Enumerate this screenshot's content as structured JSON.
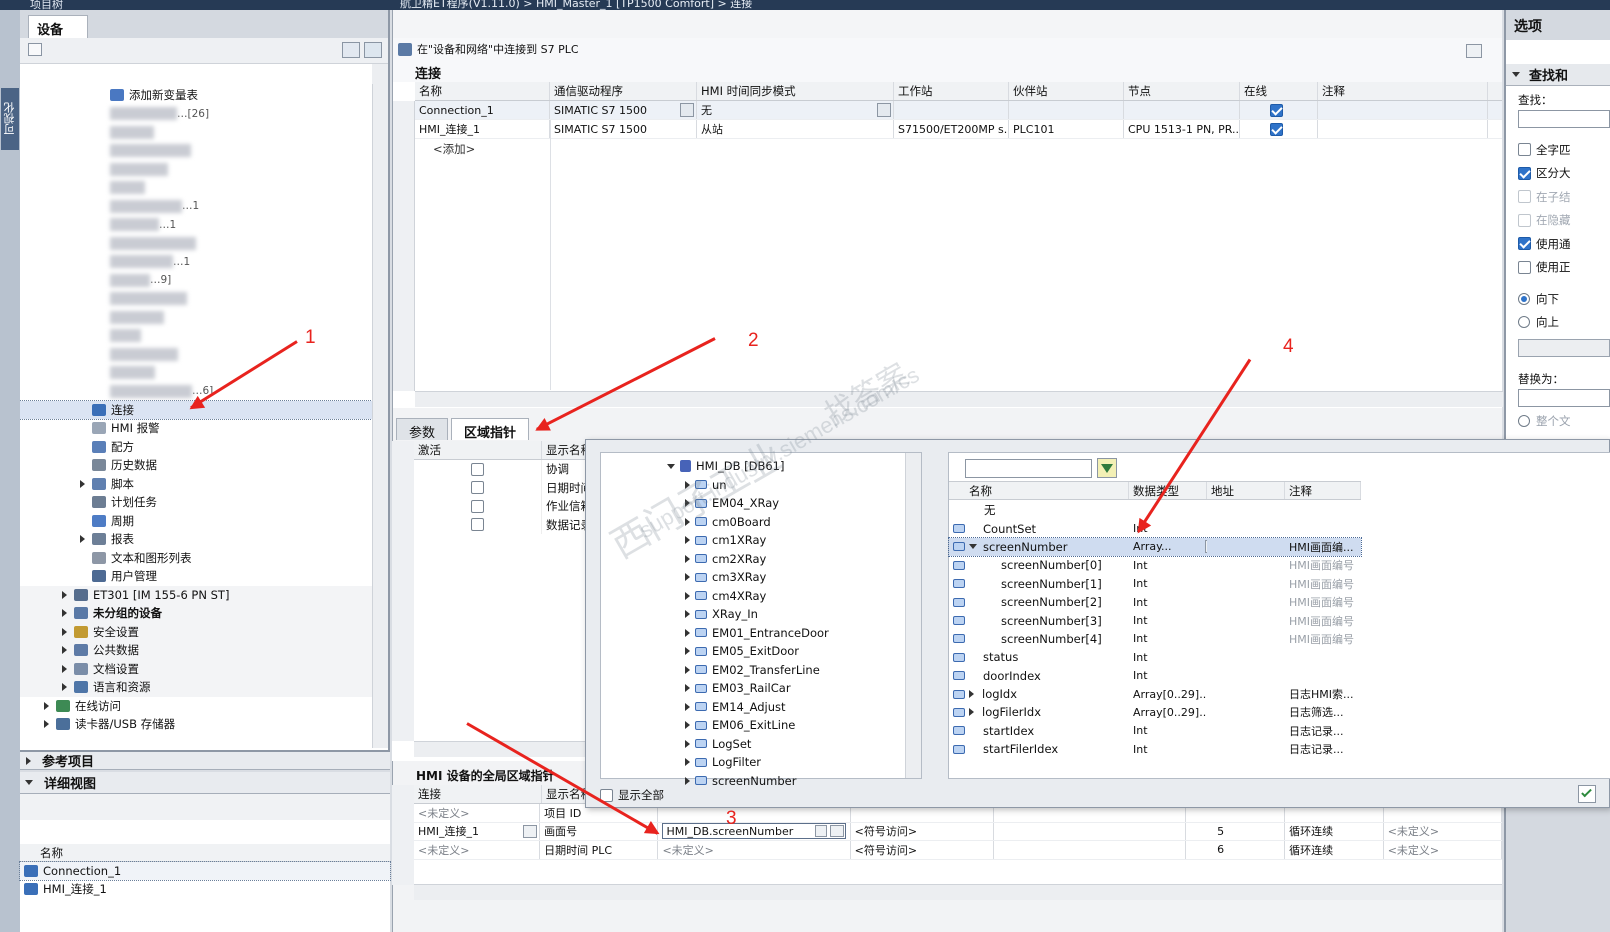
{
  "top": {
    "left_title": "项目树",
    "breadcrumb": "航卫精ET程序(V1.11.0) > HMI_Master_1 [TP1500 Comfort] > 连接",
    "right_title": "选项"
  },
  "left_vtab": "可视化",
  "devices": {
    "tab": "设备",
    "tree": [
      {
        "label": "添加新变量表",
        "indent": 90,
        "icon": "#4a78c2"
      },
      {
        "label": "…[26]",
        "indent": 90,
        "blur": true
      },
      {
        "label": "",
        "indent": 90,
        "blur": true
      },
      {
        "label": "",
        "indent": 90,
        "blur": true
      },
      {
        "label": "",
        "indent": 90,
        "blur": true
      },
      {
        "label": "",
        "indent": 90,
        "blur": true
      },
      {
        "label": "…1",
        "indent": 90,
        "blur": true
      },
      {
        "label": "…1",
        "indent": 90,
        "blur": true
      },
      {
        "label": "",
        "indent": 90,
        "blur": true
      },
      {
        "label": "…1",
        "indent": 90,
        "blur": true
      },
      {
        "label": "…9]",
        "indent": 90,
        "blur": true
      },
      {
        "label": "",
        "indent": 90,
        "blur": true
      },
      {
        "label": "",
        "indent": 90,
        "blur": true
      },
      {
        "label": "",
        "indent": 90,
        "blur": true
      },
      {
        "label": "",
        "indent": 90,
        "blur": true
      },
      {
        "label": "",
        "indent": 90,
        "blur": true
      },
      {
        "label": "…6]",
        "indent": 90,
        "blur": true
      },
      {
        "label": "连接",
        "indent": 72,
        "icon": "#3a6fb8",
        "selected": true
      },
      {
        "label": "HMI 报警",
        "indent": 72,
        "icon": "#9aa6b6"
      },
      {
        "label": "配方",
        "indent": 72,
        "icon": "#5a7fb8"
      },
      {
        "label": "历史数据",
        "indent": 72,
        "icon": "#7a8899"
      },
      {
        "label": "脚本",
        "indent": 72,
        "icon": "#6080b0",
        "expand": true
      },
      {
        "label": "计划任务",
        "indent": 72,
        "icon": "#6c7d93"
      },
      {
        "label": "周期",
        "indent": 72,
        "icon": "#4e7cc5"
      },
      {
        "label": "报表",
        "indent": 72,
        "icon": "#6d7f97",
        "expand": true
      },
      {
        "label": "文本和图形列表",
        "indent": 72,
        "icon": "#8d97a6"
      },
      {
        "label": "用户管理",
        "indent": 72,
        "icon": "#4d6a93"
      },
      {
        "label": "ET301 [IM 155-6 PN ST]",
        "indent": 54,
        "icon": "#566d8d",
        "expand": true
      },
      {
        "label": "未分组的设备",
        "indent": 54,
        "icon": "#5a79a6",
        "expand": true,
        "bold": true
      },
      {
        "label": "安全设置",
        "indent": 54,
        "icon": "#c29a32",
        "expand": true
      },
      {
        "label": "公共数据",
        "indent": 54,
        "icon": "#5d7aa6",
        "expand": true
      },
      {
        "label": "文档设置",
        "indent": 54,
        "icon": "#7a8da8",
        "expand": true
      },
      {
        "label": "语言和资源",
        "indent": 54,
        "icon": "#4f76a8",
        "expand": true
      },
      {
        "label": "在线访问",
        "indent": 36,
        "icon": "#3d8a54",
        "expand": true
      },
      {
        "label": "读卡器/USB 存储器",
        "indent": 36,
        "icon": "#4b6f9a",
        "expand": true
      }
    ]
  },
  "ref_projects": "参考项目",
  "detail_view": {
    "title": "详细视图",
    "col_name": "名称",
    "rows": [
      "Connection_1",
      "HMI_连接_1"
    ]
  },
  "connections": {
    "header_line": "在\"设备和网络\"中连接到 S7 PLC",
    "title": "连接",
    "columns": [
      "名称",
      "通信驱动程序",
      "HMI 时间同步模式",
      "工作站",
      "伙伴站",
      "节点",
      "在线",
      "注释"
    ],
    "rows": [
      {
        "name": "Connection_1",
        "driver": "SIMATIC S7 1500",
        "sync": "无",
        "station": "",
        "partner": "",
        "node": "",
        "online": true
      },
      {
        "name": "HMI_连接_1",
        "driver": "SIMATIC S7 1500",
        "sync": "从站",
        "station": "S71500/ET200MP s...",
        "partner": "PLC101",
        "node": "CPU 1513-1 PN, PR...",
        "online": true
      }
    ],
    "add": "<添加>"
  },
  "lower_tabs": [
    "参数",
    "区域指针"
  ],
  "area": {
    "col_active": "激活",
    "col_display": "显示名称",
    "rows": [
      "协调",
      "日期时间",
      "作业信箱",
      "数据记录"
    ]
  },
  "global": {
    "title": "HMI 设备的全局区域指针",
    "col_conn": "连接",
    "col_disp": "显示名称",
    "rows": [
      {
        "conn": "<未定义>",
        "disp": "项目 ID",
        "tag": "",
        "access": "",
        "len": "",
        "mode": "",
        "comment": ""
      },
      {
        "conn": "HMI_连接_1",
        "disp": "画面号",
        "tag": "HMI_DB.screenNumber",
        "access": "<符号访问>",
        "len": "5",
        "mode": "循环连续",
        "comment": "<未定义>"
      },
      {
        "conn": "<未定义>",
        "disp": "日期时间 PLC",
        "tag": "<未定义>",
        "access": "<符号访问>",
        "len": "6",
        "mode": "循环连续",
        "comment": "<未定义>"
      }
    ]
  },
  "popup": {
    "root": "HMI_DB [DB61]",
    "items": [
      "un",
      "EM04_XRay",
      "cm0Board",
      "cm1XRay",
      "cm2XRay",
      "cm3XRay",
      "cm4XRay",
      "XRay_In",
      "EM01_EntranceDoor",
      "EM05_ExitDoor",
      "EM02_TransferLine",
      "EM03_RailCar",
      "EM14_Adjust",
      "EM06_ExitLine",
      "LogSet",
      "LogFilter",
      "screenNumber"
    ],
    "cols": [
      "名称",
      "数据类型",
      "地址",
      "注释"
    ],
    "rows": [
      {
        "name": "无",
        "type": "",
        "comment": "",
        "lvl": 0
      },
      {
        "name": "CountSet",
        "type": "Int",
        "comment": "",
        "lvl": 0
      },
      {
        "name": "screenNumber",
        "type": "Array...",
        "comment": "HMI画面编...",
        "lvl": 0,
        "sel": true,
        "open": true
      },
      {
        "name": "screenNumber[0]",
        "type": "Int",
        "comment": "HMI画面编号",
        "lvl": 1
      },
      {
        "name": "screenNumber[1]",
        "type": "Int",
        "comment": "HMI画面编号",
        "lvl": 1
      },
      {
        "name": "screenNumber[2]",
        "type": "Int",
        "comment": "HMI画面编号",
        "lvl": 1
      },
      {
        "name": "screenNumber[3]",
        "type": "Int",
        "comment": "HMI画面编号",
        "lvl": 1
      },
      {
        "name": "screenNumber[4]",
        "type": "Int",
        "comment": "HMI画面编号",
        "lvl": 1
      },
      {
        "name": "status",
        "type": "Int",
        "comment": "",
        "lvl": 0
      },
      {
        "name": "doorIndex",
        "type": "Int",
        "comment": "",
        "lvl": 0
      },
      {
        "name": "logIdx",
        "type": "Array[0..29]...",
        "comment": "日志HMI索...",
        "lvl": 0,
        "expand": true
      },
      {
        "name": "logFilerIdx",
        "type": "Array[0..29]...",
        "comment": "日志筛选...",
        "lvl": 0,
        "expand": true
      },
      {
        "name": "startIdex",
        "type": "Int",
        "comment": "日志记录...",
        "lvl": 0
      },
      {
        "name": "startFilerIdex",
        "type": "Int",
        "comment": "日志记录...",
        "lvl": 0
      }
    ],
    "show_all": "显示全部"
  },
  "options": {
    "section": "查找和",
    "find_label": "查找：",
    "checks": [
      {
        "label": "全字匹",
        "on": false,
        "dis": false
      },
      {
        "label": "区分大",
        "on": true,
        "dis": false
      },
      {
        "label": "在子结",
        "on": false,
        "dis": true
      },
      {
        "label": "在隐藏",
        "on": false,
        "dis": true
      },
      {
        "label": "使用通",
        "on": true,
        "dis": false
      },
      {
        "label": "使用正",
        "on": false,
        "dis": false
      }
    ],
    "down": "向下",
    "up": "向上",
    "replace": "替换为：",
    "whole": "整个文"
  },
  "annotations": [
    "1",
    "2",
    "3",
    "4"
  ],
  "watermark": [
    "西门子工业",
    "support.industry.siemens.com/cs",
    "找答案"
  ]
}
